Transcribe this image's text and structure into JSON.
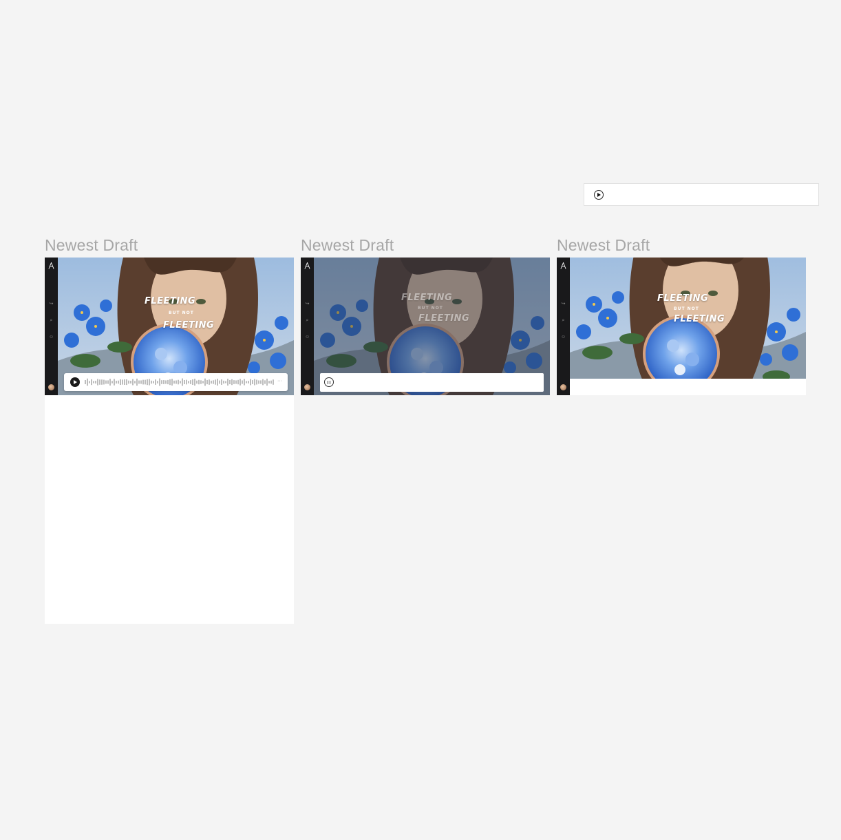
{
  "page": {
    "draft_label": "Newest Draft"
  },
  "hero": {
    "title_top": "FLEETING",
    "title_mid": "BUT NOT",
    "title_bottom": "FLEETING"
  },
  "rail": {
    "icons": [
      "share-icon",
      "search-icon",
      "emoji-icon"
    ]
  },
  "audio": {
    "more_label": "···"
  },
  "colors": {
    "rail_bg": "#19191b",
    "page_bg": "#f4f4f4",
    "flower_blue": "#2f6fd6"
  }
}
